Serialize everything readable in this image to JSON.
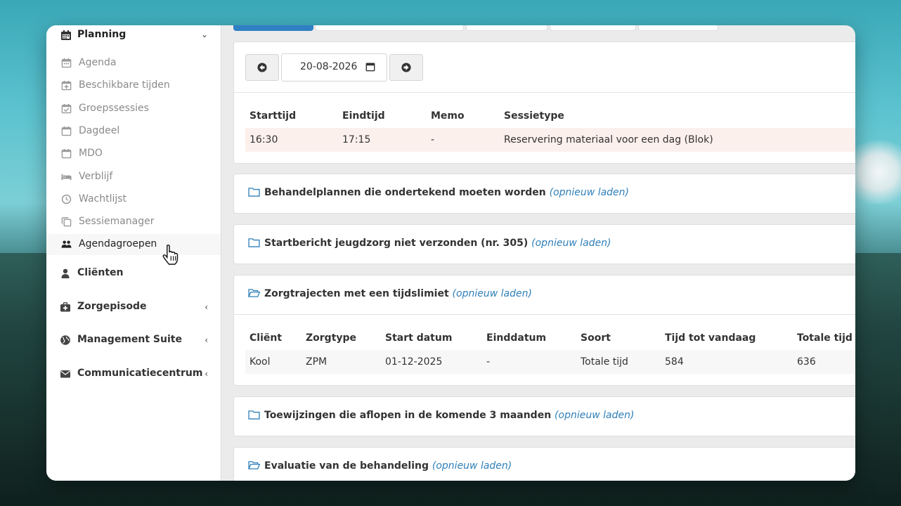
{
  "sidebar": {
    "planning_label": "Planning",
    "items": [
      {
        "label": "Agenda",
        "icon": "calendar-icon"
      },
      {
        "label": "Beschikbare tijden",
        "icon": "calendar-plus-icon"
      },
      {
        "label": "Groepssessies",
        "icon": "calendar-check-icon"
      },
      {
        "label": "Dagdeel",
        "icon": "calendar-icon"
      },
      {
        "label": "MDO",
        "icon": "calendar-icon"
      },
      {
        "label": "Verblijf",
        "icon": "bed-icon"
      },
      {
        "label": "Wachtlijst",
        "icon": "clock-icon"
      },
      {
        "label": "Sessiemanager",
        "icon": "copy-icon"
      },
      {
        "label": "Agendagroepen",
        "icon": "users-icon"
      }
    ],
    "main_items": [
      {
        "label": "Cliënten",
        "icon": "user-icon"
      },
      {
        "label": "Zorgepisode",
        "icon": "medkit-icon"
      },
      {
        "label": "Management Suite",
        "icon": "globe-icon"
      },
      {
        "label": "Communicatiecentrum",
        "icon": "envelope-icon"
      }
    ]
  },
  "date_nav": {
    "date_value": "20-08-2026"
  },
  "sessions": {
    "columns": [
      "Starttijd",
      "Eindtijd",
      "Memo",
      "Sessietype"
    ],
    "rows": [
      [
        "16:30",
        "17:15",
        "-",
        "Reservering materiaal voor een dag (Blok)"
      ]
    ]
  },
  "reload_label": "(opnieuw laden)",
  "panels": {
    "behandelplannen": "Behandelplannen die ondertekend moeten worden",
    "startbericht": "Startbericht jeugdzorg niet verzonden (nr. 305)",
    "zorgtrajecten": "Zorgtrajecten met een tijdslimiet",
    "toewijzingen": "Toewijzingen die aflopen in de komende 3 maanden",
    "evaluatie": "Evaluatie van de behandeling"
  },
  "zorgtrajecten_table": {
    "columns": [
      "Cliënt",
      "Zorgtype",
      "Start datum",
      "Einddatum",
      "Soort",
      "Tijd tot vandaag",
      "Totale tijd"
    ],
    "rows": [
      [
        "Kool",
        "ZPM",
        "01-12-2025",
        "-",
        "Totale tijd",
        "584",
        "636"
      ]
    ]
  },
  "colors": {
    "accent": "#2f80c4",
    "link": "#2f7fb8",
    "row_highlight": "#fcf0ed"
  }
}
